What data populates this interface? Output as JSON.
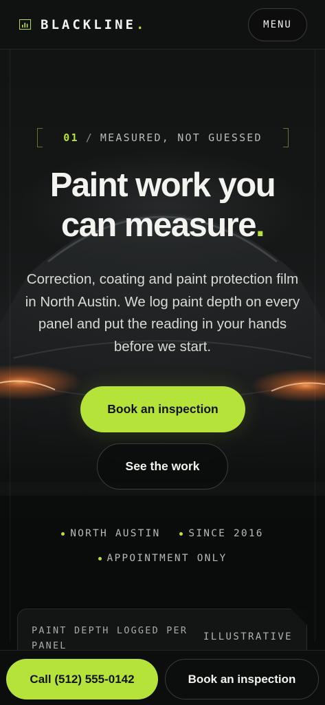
{
  "header": {
    "brand_name": "BLACKLINE",
    "brand_dot": ".",
    "brand_icon": "bar-chart-icon",
    "menu_label": "MENU"
  },
  "hero": {
    "eyebrow_number": "01",
    "eyebrow_separator": "/",
    "eyebrow_text": "MEASURED, NOT GUESSED",
    "headline_line1": "Paint work you",
    "headline_line2": "can measure",
    "headline_dot": ".",
    "lede": "Correction, coating and paint protection film in North Austin. We log paint depth on every panel and put the reading in your hands before we start.",
    "primary_cta": "Book an inspection",
    "secondary_cta": "See the work"
  },
  "tags": [
    "NORTH AUSTIN",
    "SINCE 2016",
    "APPOINTMENT ONLY"
  ],
  "card": {
    "label": "PAINT DEPTH LOGGED PER PANEL",
    "tag": "ILLUSTRATIVE"
  },
  "bottom_bar": {
    "call_label": "Call (512) 555-0142",
    "book_label": "Book an inspection"
  },
  "colors": {
    "accent": "#b6e33a",
    "background": "#0b0c0c",
    "text": "#f3f3ef"
  }
}
